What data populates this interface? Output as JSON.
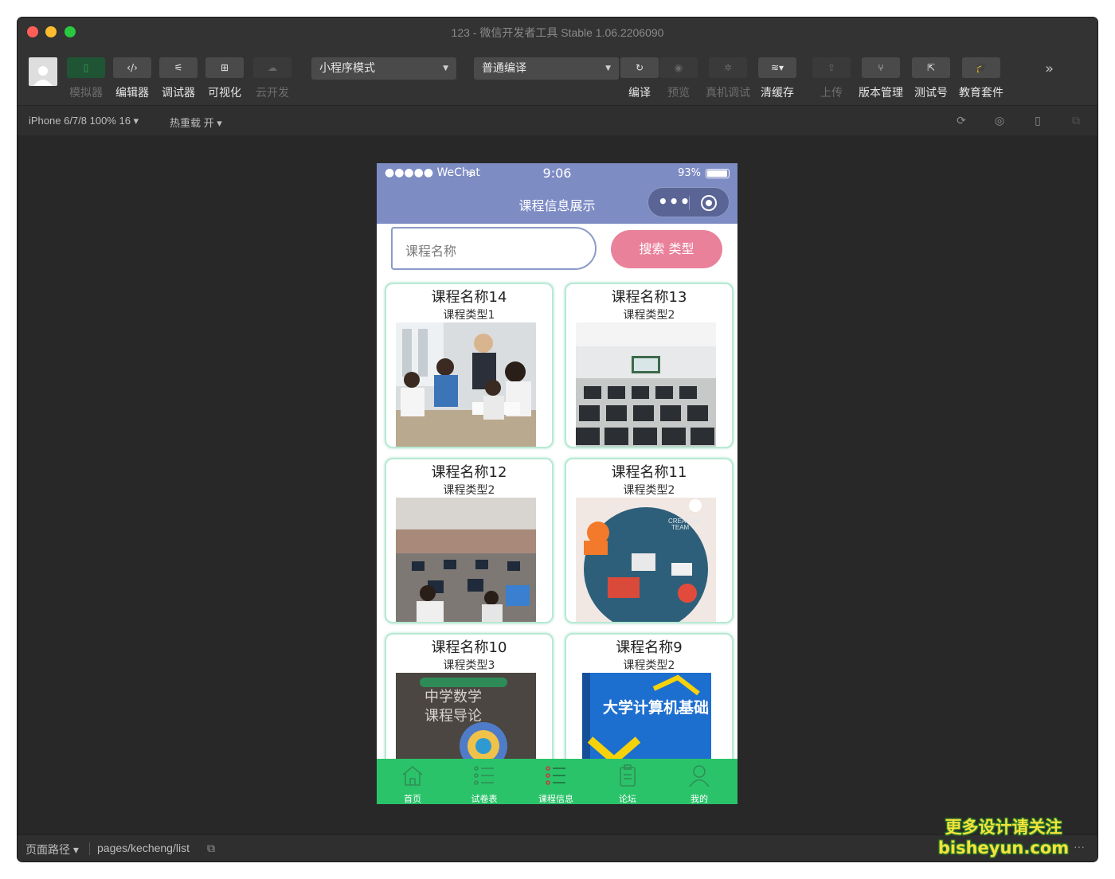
{
  "window": {
    "title": "123 - 微信开发者工具 Stable 1.06.2206090"
  },
  "toolbar": {
    "simulator_label": "模拟器",
    "editor_label": "编辑器",
    "debugger_label": "调试器",
    "visual_label": "可视化",
    "cloud_label": "云开发",
    "mode_select": "小程序模式",
    "compile_select": "普通编译",
    "compile_label": "编译",
    "preview_label": "预览",
    "remote_debug_label": "真机调试",
    "clear_cache_label": "清缓存",
    "upload_label": "上传",
    "version_label": "版本管理",
    "test_label": "测试号",
    "edu_label": "教育套件"
  },
  "subbar": {
    "device": "iPhone 6/7/8 100% 16",
    "hot_reload": "热重载 开"
  },
  "phone": {
    "carrier": "●●●●● WeChat",
    "time": "9:06",
    "battery": "93%",
    "nav_title": "课程信息展示",
    "capsule_dots": "•••",
    "search_placeholder": "课程名称",
    "search_button": "搜索  类型",
    "cards": [
      {
        "title": "课程名称14",
        "type": "课程类型1"
      },
      {
        "title": "课程名称13",
        "type": "课程类型2"
      },
      {
        "title": "课程名称12",
        "type": "课程类型2"
      },
      {
        "title": "课程名称11",
        "type": "课程类型2"
      },
      {
        "title": "课程名称10",
        "type": "课程类型3"
      },
      {
        "title": "课程名称9",
        "type": "课程类型2"
      }
    ],
    "card_images": {
      "creative_team": "CREATIVE\nTEAM",
      "book_math": "中学数学\n课程导论",
      "book_cs": "大学计算机基础"
    },
    "tabs": [
      {
        "label": "首页",
        "icon": "home-icon"
      },
      {
        "label": "试卷表",
        "icon": "list-icon"
      },
      {
        "label": "课程信息",
        "icon": "list-active-icon"
      },
      {
        "label": "论坛",
        "icon": "clipboard-icon"
      },
      {
        "label": "我的",
        "icon": "user-icon"
      }
    ]
  },
  "footer": {
    "path_label": "页面路径",
    "path_value": "pages/kecheng/list",
    "more": "···"
  },
  "watermark": {
    "line1": "更多设计请关注",
    "line2": "bisheyun.com"
  },
  "colors": {
    "nav_bg": "#7e8cc4",
    "tabbar_bg": "#2bc36a",
    "search_button_bg": "#e9819b",
    "card_border": "#b9e9d3"
  }
}
